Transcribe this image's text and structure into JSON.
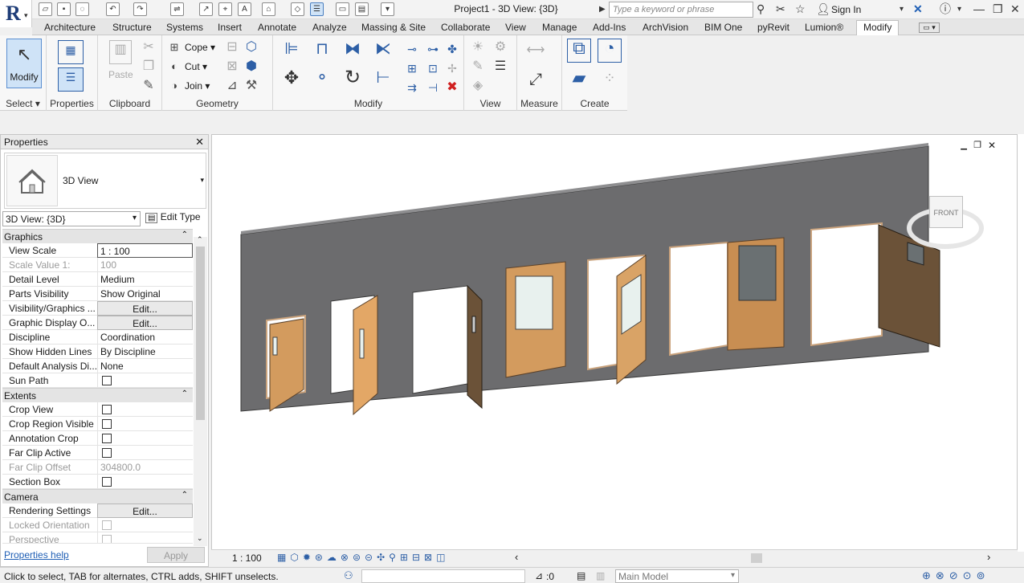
{
  "app": {
    "title": "Project1 - 3D View: {3D}"
  },
  "search": {
    "placeholder": "Type a keyword or phrase"
  },
  "account": {
    "sign_in": "Sign In"
  },
  "tabs": [
    "Architecture",
    "Structure",
    "Systems",
    "Insert",
    "Annotate",
    "Analyze",
    "Massing & Site",
    "Collaborate",
    "View",
    "Manage",
    "Add-Ins",
    "ArchVision",
    "BIM One",
    "pyRevit",
    "Lumion®",
    "Modify"
  ],
  "active_tab": "Modify",
  "ribbon": {
    "modify_label": "Modify",
    "paste_label": "Paste",
    "cope_label": "Cope",
    "cut_label": "Cut",
    "join_label": "Join",
    "panels": {
      "select": "Select",
      "properties": "Properties",
      "clipboard": "Clipboard",
      "geometry": "Geometry",
      "modify": "Modify",
      "view": "View",
      "measure": "Measure",
      "create": "Create"
    }
  },
  "properties": {
    "header": "Properties",
    "type_name": "3D View",
    "view_dropdown": "3D View: {3D}",
    "edit_type": "Edit Type",
    "sections": {
      "graphics": "Graphics",
      "extents": "Extents",
      "camera": "Camera"
    },
    "graphics_rows": [
      {
        "k": "View Scale",
        "v": "1 : 100"
      },
      {
        "k": "Scale Value    1:",
        "v": "100"
      },
      {
        "k": "Detail Level",
        "v": "Medium"
      },
      {
        "k": "Parts Visibility",
        "v": "Show Original"
      },
      {
        "k": "Visibility/Graphics ...",
        "v": "Edit..."
      },
      {
        "k": "Graphic Display O...",
        "v": "Edit..."
      },
      {
        "k": "Discipline",
        "v": "Coordination"
      },
      {
        "k": "Show Hidden Lines",
        "v": "By Discipline"
      },
      {
        "k": "Default Analysis Di...",
        "v": "None"
      },
      {
        "k": "Sun Path",
        "v": ""
      }
    ],
    "extents_rows": [
      {
        "k": "Crop View",
        "v": ""
      },
      {
        "k": "Crop Region Visible",
        "v": ""
      },
      {
        "k": "Annotation Crop",
        "v": ""
      },
      {
        "k": "Far Clip Active",
        "v": ""
      },
      {
        "k": "Far Clip Offset",
        "v": "304800.0"
      },
      {
        "k": "Section Box",
        "v": ""
      }
    ],
    "camera_rows": [
      {
        "k": "Rendering Settings",
        "v": "Edit..."
      },
      {
        "k": "Locked Orientation",
        "v": ""
      },
      {
        "k": "Perspective",
        "v": ""
      }
    ],
    "help": "Properties help",
    "apply": "Apply"
  },
  "viewport": {
    "scale": "1 : 100",
    "viewcube_face": "FRONT"
  },
  "status": {
    "text": "Click to select, TAB for alternates, CTRL adds, SHIFT unselects.",
    "filter_count": ":0",
    "model": "Main Model"
  },
  "colors": {
    "wall": "#6c6c6e",
    "door": "#d39b5e",
    "door_dark": "#6b5238",
    "frame": "#e2bb93",
    "glass": "#e8f1ee",
    "glass_dark": "#6a7072",
    "accent": "#cfe3f7"
  }
}
